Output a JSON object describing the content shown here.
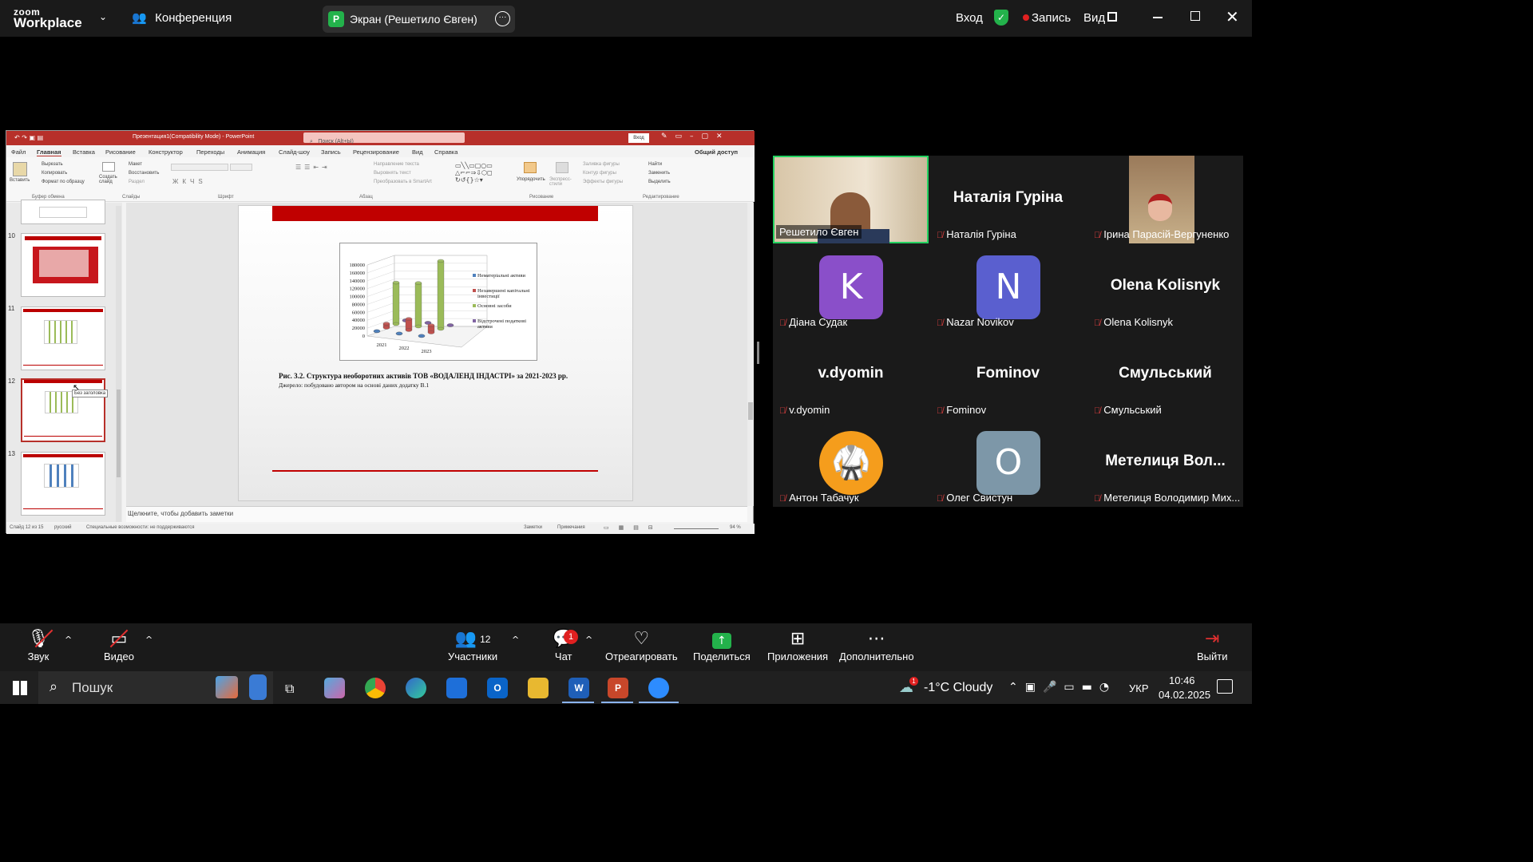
{
  "zoom": {
    "logo_top": "zoom",
    "logo_bottom": "Workplace",
    "meeting_label": "Конференция",
    "share_badge": "P",
    "share_title": "Экран (Решетило Євген)",
    "signin": "Вход",
    "record": "Запись",
    "view": "Вид"
  },
  "ppt": {
    "title": "Презентация1(Compatibility Mode) - PowerPoint",
    "search": "Поиск (Alt+Ы)",
    "signin": "Вход",
    "share": "Общий доступ",
    "menu": [
      "Файл",
      "Главная",
      "Вставка",
      "Рисование",
      "Конструктор",
      "Переходы",
      "Анимация",
      "Слайд-шоу",
      "Запись",
      "Рецензирование",
      "Вид",
      "Справка"
    ],
    "ribbon": {
      "paste": "Вставить",
      "cut": "Вырезать",
      "copy": "Копировать",
      "format_painter": "Формат по образцу",
      "new_slide": "Создать слайд",
      "layout": "Макет",
      "reset": "Восстановить",
      "section": "Раздел",
      "text_dir": "Направление текста",
      "align_text": "Выровнять текст",
      "smartart": "Преобразовать в SmartArt",
      "arrange": "Упорядочить",
      "quick_styles": "Экспресс-стили",
      "fill": "Заливка фигуры",
      "outline": "Контур фигуры",
      "effects": "Эффекты фигуры",
      "find": "Найти",
      "replace": "Заменить",
      "select": "Выделить",
      "groups": [
        "Буфер обмена",
        "Слайды",
        "Шрифт",
        "Абзац",
        "Рисование",
        "Редактирование"
      ]
    },
    "thumb_nums": [
      "10",
      "11",
      "12",
      "13"
    ],
    "tooltip": "Без заголовка",
    "notes": "Щелкните, чтобы добавить заметки",
    "status_slide": "Слайд 12 из 15",
    "status_lang": "русский",
    "status_access": "Специальные возможности: не поддерживаются",
    "status_notes": "Заметки",
    "status_comments": "Примечания",
    "zoom": "94 %",
    "caption": "Рис. 3.2. Структура необоротних  активів ТОВ «ВОДАЛЕНД ІНДАСТРІ» за 2021-2023 рр.",
    "source": "Джерело: побудовано автором на основі даних додатку В.1"
  },
  "chart_data": {
    "type": "bar",
    "categories": [
      "2021",
      "2022",
      "2023"
    ],
    "yticks": [
      "180000",
      "160000",
      "140000",
      "120000",
      "100000",
      "80000",
      "60000",
      "40000",
      "20000",
      "0"
    ],
    "ylim": [
      0,
      180000
    ],
    "series": [
      {
        "name": "Нематеріальні активи",
        "color": "#4f81bd",
        "values": [
          200,
          300,
          400
        ]
      },
      {
        "name": "Незавершені капітальні інвестиції",
        "color": "#c0504d",
        "values": [
          10000,
          28000,
          18000
        ]
      },
      {
        "name": "Основні засоби",
        "color": "#9bbb59",
        "values": [
          105000,
          110000,
          172000
        ]
      },
      {
        "name": "Відстрочені податкові активи",
        "color": "#8064a2",
        "values": [
          0,
          0,
          0
        ]
      }
    ]
  },
  "participants": [
    {
      "name": "Решетило Євген",
      "type": "video"
    },
    {
      "name": "Наталія Гуріна",
      "big": "Наталія Гуріна",
      "type": "text"
    },
    {
      "name": "Ірина Парасій-Вергуненко",
      "type": "video2"
    },
    {
      "name": "Діана Судак",
      "letter": "K",
      "color": "#8a4fc9",
      "type": "avatar"
    },
    {
      "name": "Nazar Novikov",
      "letter": "N",
      "color": "#5a5fcf",
      "type": "avatar"
    },
    {
      "name": "Olena Kolisnyk",
      "big": "Olena Kolisnyk",
      "type": "text"
    },
    {
      "name": "v.dyomin",
      "big": "v.dyomin",
      "type": "text"
    },
    {
      "name": "Fominov",
      "big": "Fominov",
      "type": "text"
    },
    {
      "name": "Смульський",
      "big": "Смульський",
      "type": "text"
    },
    {
      "name": "Антон Табачук",
      "type": "photo"
    },
    {
      "name": "Олег Свистун",
      "letter": "O",
      "color": "#7d97a8",
      "type": "avatar"
    },
    {
      "name": "Метелиця Володимир Мих...",
      "big": "Метелиця  Вол...",
      "type": "text"
    }
  ],
  "toolbar": {
    "audio": "Звук",
    "video": "Видео",
    "participants": "Участники",
    "participants_count": "12",
    "chat": "Чат",
    "chat_badge": "1",
    "react": "Отреагировать",
    "share": "Поделиться",
    "apps": "Приложения",
    "more": "Дополнительно",
    "leave": "Выйти"
  },
  "taskbar": {
    "search": "Пошук",
    "weather": "-1°C  Cloudy",
    "weather_badge": "1",
    "lang": "УКР",
    "time": "10:46",
    "date": "04.02.2025"
  }
}
